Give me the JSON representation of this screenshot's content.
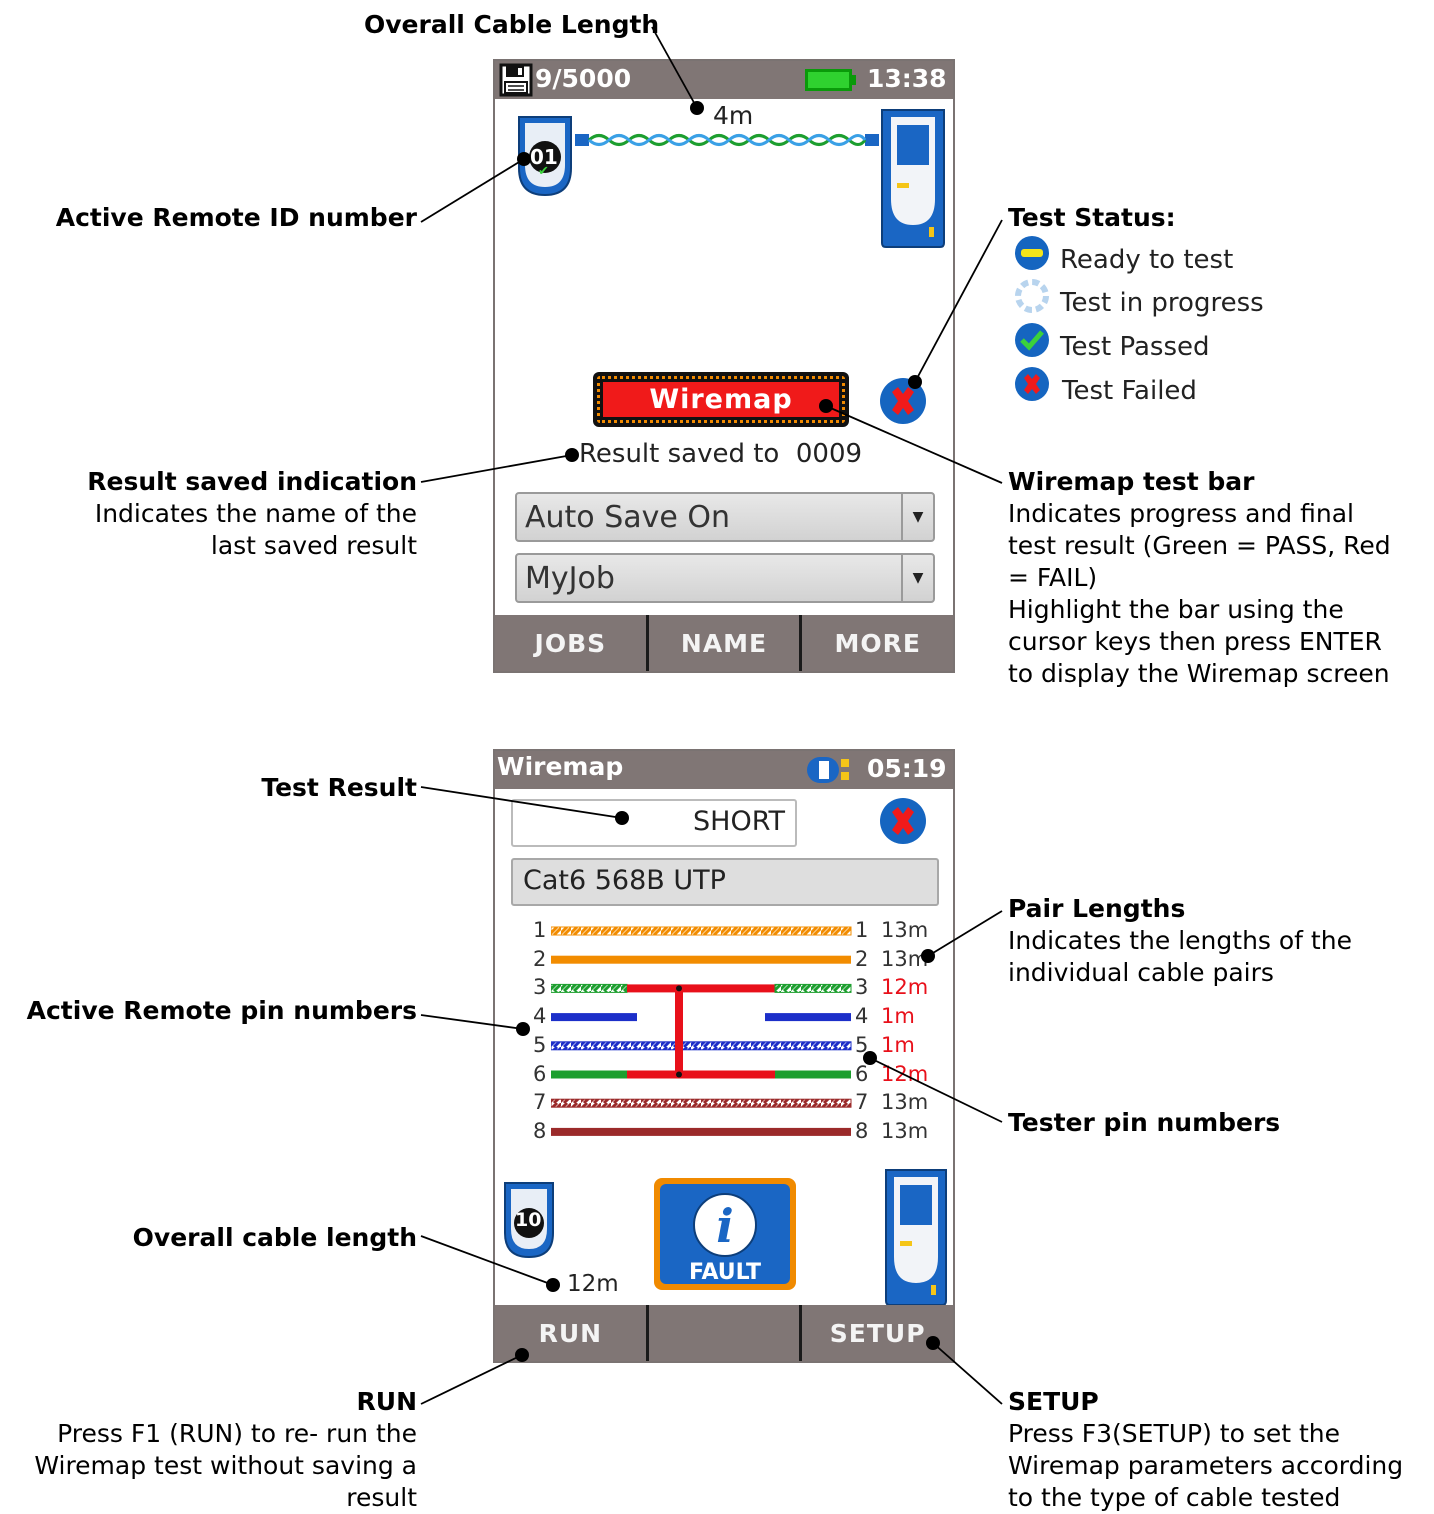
{
  "screen1": {
    "saved_count": "9/5000",
    "clock": "13:38",
    "overall_length": "4m",
    "remote_id": "01",
    "test_bar_label": "Wiremap",
    "result_saved": "Result saved to  0009",
    "autosave": "Auto Save On",
    "job": "MyJob",
    "fkeys": [
      "JOBS",
      "NAME",
      "MORE"
    ]
  },
  "screen2": {
    "title": "Wiremap",
    "clock": "05:19",
    "result": "SHORT",
    "cable_type": "Cat6 568B UTP",
    "pins": [
      {
        "left": "1",
        "right": "1",
        "length": "13m",
        "color": "#f28c00",
        "style": "striped",
        "fault": false
      },
      {
        "left": "2",
        "right": "2",
        "length": "13m",
        "color": "#f28c00",
        "style": "solid",
        "fault": false
      },
      {
        "left": "3",
        "right": "3",
        "length": "12m",
        "color": "#1c9e2e",
        "style": "striped",
        "fault": true
      },
      {
        "left": "4",
        "right": "4",
        "length": "1m",
        "color": "#1c2fc9",
        "style": "solid",
        "fault": true
      },
      {
        "left": "5",
        "right": "5",
        "length": "1m",
        "color": "#1c2fc9",
        "style": "striped",
        "fault": true
      },
      {
        "left": "6",
        "right": "6",
        "length": "12m",
        "color": "#1c9e2e",
        "style": "solid",
        "fault": true
      },
      {
        "left": "7",
        "right": "7",
        "length": "13m",
        "color": "#9b2a2a",
        "style": "striped",
        "fault": false
      },
      {
        "left": "8",
        "right": "8",
        "length": "13m",
        "color": "#9b2a2a",
        "style": "solid",
        "fault": false
      }
    ],
    "remote_id": "10",
    "overall_length": "12m",
    "fault_label": "FAULT",
    "fkeys": [
      "RUN",
      "",
      "SETUP"
    ]
  },
  "callouts": {
    "overall_cable_length": "Overall Cable Length",
    "active_remote_id": "Active Remote ID number",
    "test_status_title": "Test Status:",
    "status_ready": "Ready to test",
    "status_progress": "Test in progress",
    "status_passed": "Test Passed",
    "status_failed": "Test Failed",
    "result_saved_title": "Result saved indication",
    "result_saved_body": [
      "Indicates the name of the",
      "last saved result"
    ],
    "wiremap_bar_title": "Wiremap test bar",
    "wiremap_bar_body": [
      "Indicates progress and final",
      "test result (Green = PASS, Red",
      "= FAIL)",
      "Highlight the bar using the",
      "cursor keys then press ENTER",
      "to display the Wiremap screen"
    ],
    "test_result": "Test Result",
    "pair_lengths_title": "Pair Lengths",
    "pair_lengths_body": [
      "Indicates the lengths of the",
      "individual cable pairs"
    ],
    "active_remote_pins": "Active Remote pin numbers",
    "tester_pins": "Tester pin numbers",
    "overall_cable_length_2": "Overall cable length",
    "run_title": "RUN",
    "run_body": [
      "Press F1 (RUN) to re- run the",
      "Wiremap test without saving a",
      "result"
    ],
    "setup_title": "SETUP",
    "setup_body": [
      "Press F3(SETUP) to set the",
      "Wiremap parameters according",
      "to the type of cable tested"
    ]
  },
  "colors": {
    "status_bar": "#807675",
    "fail_red": "#e8101a",
    "icon_blue": "#1565c0",
    "fault_orange": "#f08a00"
  }
}
